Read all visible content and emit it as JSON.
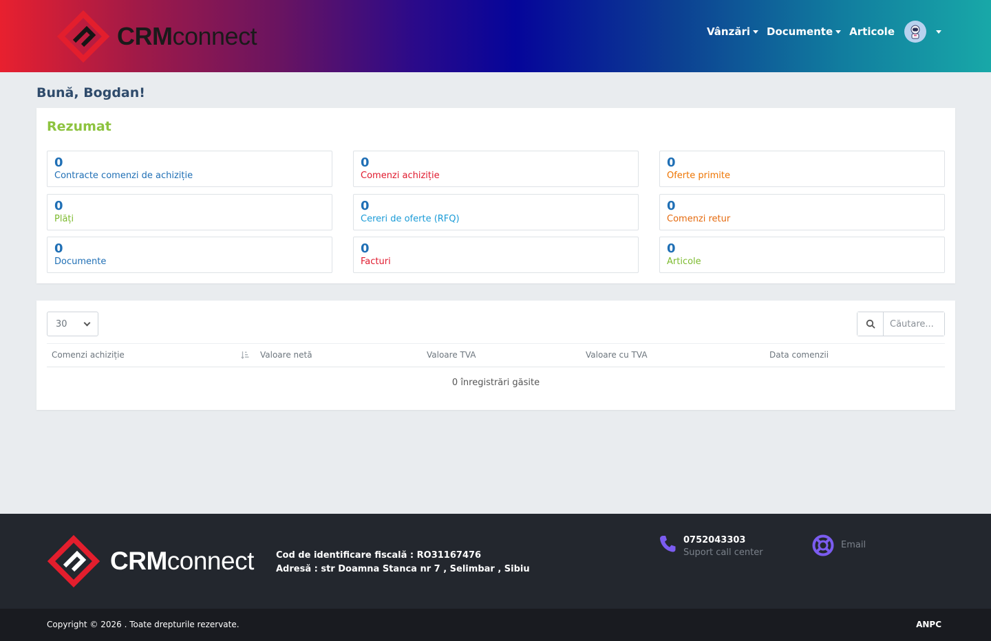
{
  "brand": {
    "bold": "CRM",
    "regular": "connect",
    "accent_color": "#e31e2d"
  },
  "nav": {
    "items": [
      {
        "label": "Vânzări",
        "has_dropdown": true
      },
      {
        "label": "Documente",
        "has_dropdown": true
      },
      {
        "label": "Articole",
        "has_dropdown": false
      }
    ],
    "avatar_icon": "astronaut-avatar-icon"
  },
  "greeting": "Bună, Bogdan!",
  "summary": {
    "title": "Rezumat",
    "stats": [
      {
        "count": "0",
        "label": "Contracte comenzi de achiziție",
        "color": "#1f6fb5"
      },
      {
        "count": "0",
        "label": "Comenzi achiziție",
        "color": "#e0192d"
      },
      {
        "count": "0",
        "label": "Oferte primite",
        "color": "#ee7400"
      },
      {
        "count": "0",
        "label": "Plăți",
        "color": "#7cba2e"
      },
      {
        "count": "0",
        "label": "Cereri de oferte (RFQ)",
        "color": "#1a9bd7"
      },
      {
        "count": "0",
        "label": "Comenzi retur",
        "color": "#e56a0e"
      },
      {
        "count": "0",
        "label": "Documente",
        "color": "#1f6fb5"
      },
      {
        "count": "0",
        "label": "Facturi",
        "color": "#e0192d"
      },
      {
        "count": "0",
        "label": "Articole",
        "color": "#7cba2e"
      }
    ]
  },
  "table": {
    "page_size": "30",
    "search_placeholder": "Căutare...",
    "columns": [
      "Comenzi achiziție",
      "Valoare netă",
      "Valoare TVA",
      "Valoare cu TVA",
      "Data comenzii"
    ],
    "empty_message": "0 înregistrări găsite"
  },
  "footer": {
    "fiscal_code": "Cod de identificare fiscală : RO31167476",
    "address": "Adresă : str Doamna Stanca nr 7 , Selimbar , Sibiu",
    "phone": {
      "number": "0752043303",
      "label": "Suport call center",
      "icon": "phone-icon"
    },
    "email": {
      "label": "Email",
      "icon": "lifebuoy-icon"
    },
    "contact_icon_color": "#7b5cf0",
    "copyright": "Copyright © 2026 . Toate drepturile rezervate.",
    "anpc": "ANPC"
  }
}
